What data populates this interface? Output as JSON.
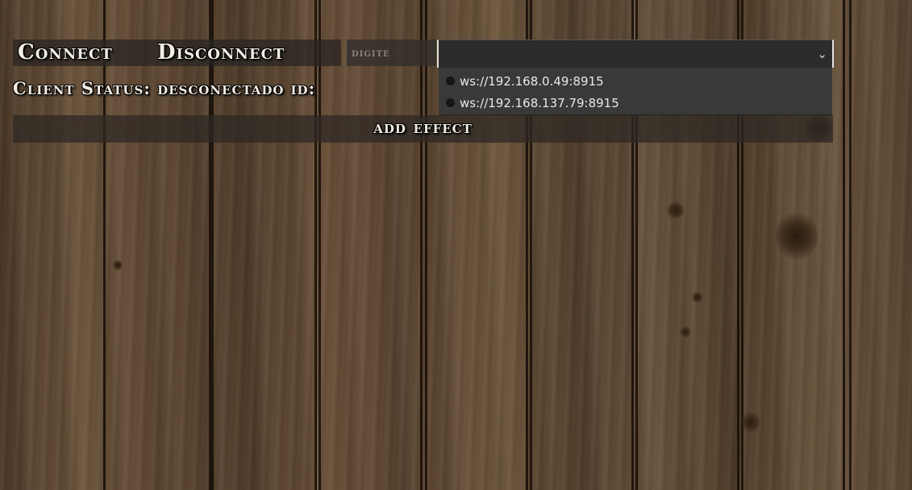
{
  "toolbar": {
    "connect_label": "Connect",
    "disconnect_label": "Disconnect",
    "input_placeholder": "digite"
  },
  "server_select": {
    "selected_value": "",
    "options": [
      "ws://192.168.0.49:8915",
      "ws://192.168.137.79:8915"
    ]
  },
  "status": {
    "label": "Client Status:",
    "value": "desconectado",
    "id_label": "id:"
  },
  "actions": {
    "add_effect_label": "add effect"
  },
  "icons": {
    "select_chevron": "chevron-down-icon",
    "option_marker": "option-dot-icon"
  },
  "colors": {
    "text": "#f2ede4",
    "button_bg": "#2e2a27",
    "dropdown_bg": "#3a3938"
  }
}
